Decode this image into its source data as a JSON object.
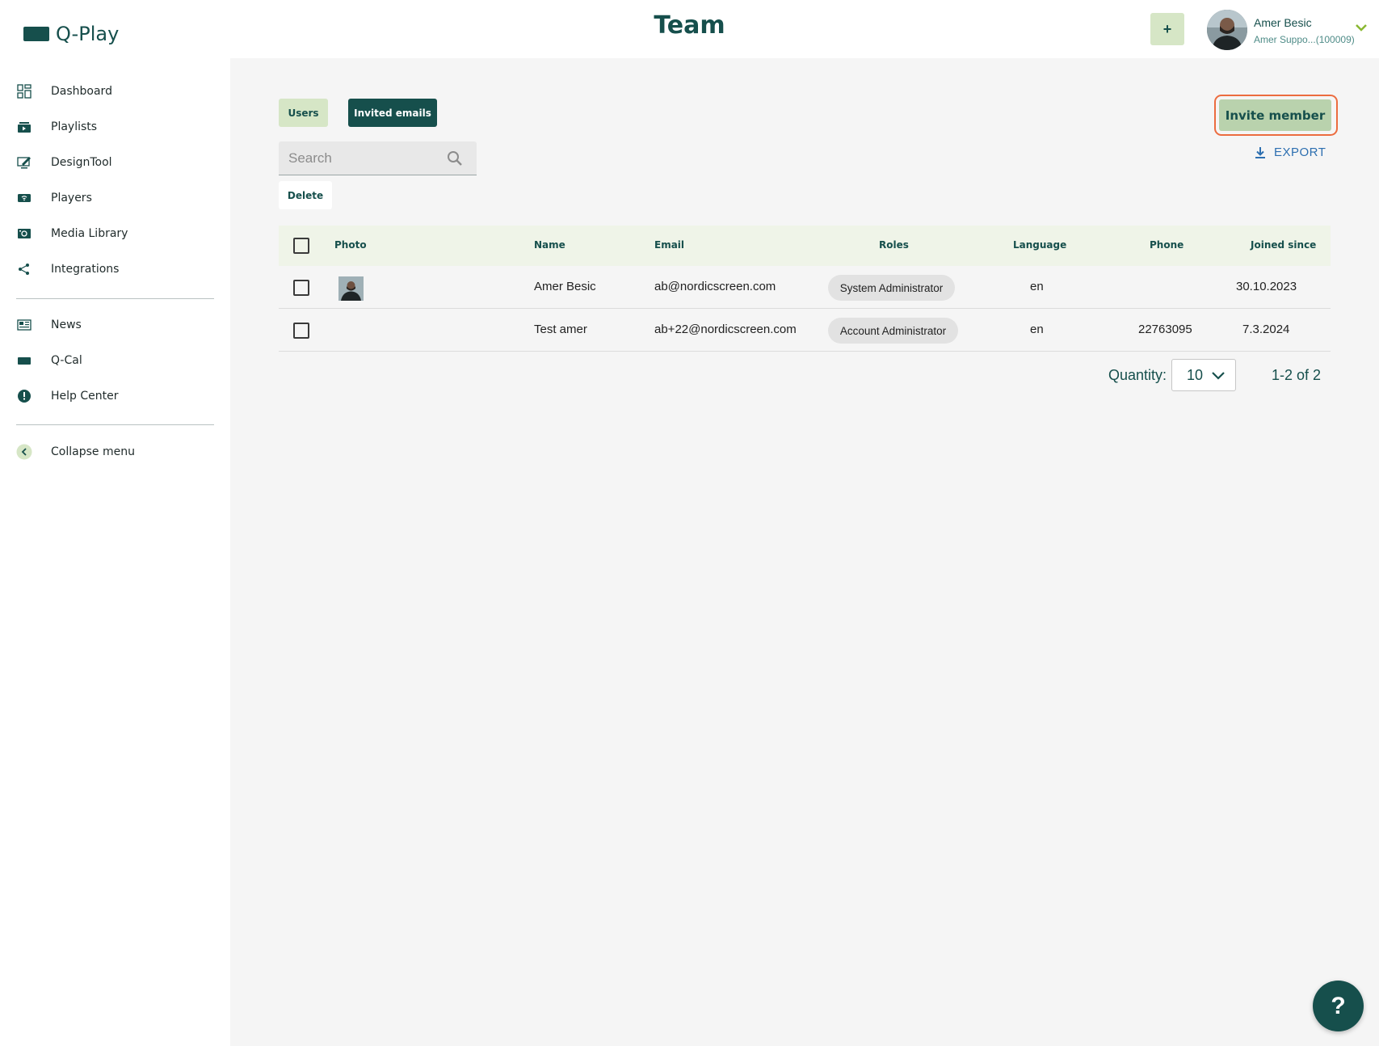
{
  "app": {
    "logo_text": "Q-Play",
    "page_title": "Team"
  },
  "header": {
    "plus_label": "+",
    "user_name": "Amer Besic",
    "user_sub": "Amer Suppo...(100009)"
  },
  "sidebar": {
    "items": [
      {
        "label": "Dashboard",
        "icon": "dashboard-icon"
      },
      {
        "label": "Playlists",
        "icon": "playlist-icon"
      },
      {
        "label": "DesignTool",
        "icon": "design-tool-icon"
      },
      {
        "label": "Players",
        "icon": "player-icon"
      },
      {
        "label": "Media Library",
        "icon": "media-library-icon"
      },
      {
        "label": "Integrations",
        "icon": "share-icon"
      },
      {
        "label": "News",
        "icon": "news-icon"
      },
      {
        "label": "Q-Cal",
        "icon": "calendar-icon"
      },
      {
        "label": "Help Center",
        "icon": "alert-circle-icon"
      },
      {
        "label": "Collapse menu",
        "icon": "chevron-left-icon"
      }
    ]
  },
  "tabs": {
    "users": "Users",
    "invited": "Invited emails"
  },
  "actions": {
    "invite_member": "Invite member",
    "export": "EXPORT",
    "delete": "Delete"
  },
  "search": {
    "placeholder": "Search"
  },
  "table": {
    "headers": {
      "photo": "Photo",
      "name": "Name",
      "email": "Email",
      "roles": "Roles",
      "language": "Language",
      "phone": "Phone",
      "joined": "Joined since"
    },
    "rows": [
      {
        "name": "Amer Besic",
        "email": "ab@nordicscreen.com",
        "role": "System Administrator",
        "language": "en",
        "phone": "",
        "joined": "30.10.2023",
        "has_photo": true
      },
      {
        "name": "Test amer",
        "email": "ab+22@nordicscreen.com",
        "role": "Account Administrator",
        "language": "en",
        "phone": "22763095",
        "joined": "7.3.2024",
        "has_photo": false
      }
    ]
  },
  "pagination": {
    "quantity_label": "Quantity:",
    "quantity_value": "10",
    "range": "1-2 of 2"
  },
  "help_fab": "?",
  "colors": {
    "brand": "#164f4c",
    "accent_light": "#d6e6c6",
    "highlight": "#ec6c3f",
    "link": "#2d6fb0"
  }
}
